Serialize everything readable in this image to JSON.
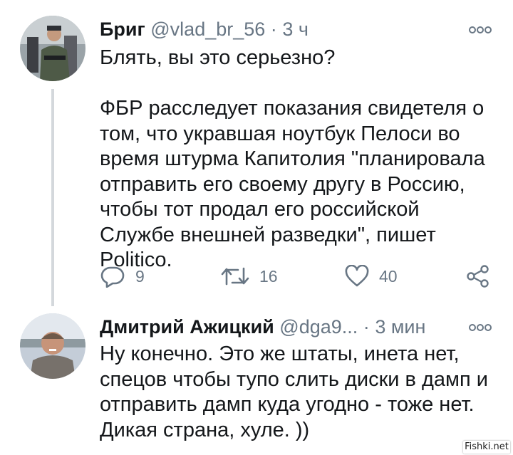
{
  "tweets": [
    {
      "name": "Бриг",
      "handle": "@vlad_br_56",
      "separator": "·",
      "time": "3 ч",
      "text": "Блять, вы это серьезно?\n\nФБР расследует показания свидетеля о том, что укравшая ноутбук Пелоси во время штурма Капитолия \"планировала отправить его своему другу в Россию, чтобы тот продал его российской Службе внешней разведки\", пишет Politico.",
      "replies": "9",
      "retweets": "16",
      "likes": "40"
    },
    {
      "name": "Дмитрий Ажицкий",
      "handle": "@dga9...",
      "separator": "·",
      "time": "3 мин",
      "text": "Ну конечно. Это же штаты, инета нет, спецов чтобы тупо слить диски в дамп и отправить дамп куда угодно - тоже нет. Дикая страна, хуле. ))"
    }
  ],
  "watermark": "Fishki.net",
  "colors": {
    "text": "#14171a",
    "secondary": "#687684",
    "thread_line": "#d4d8dc"
  }
}
